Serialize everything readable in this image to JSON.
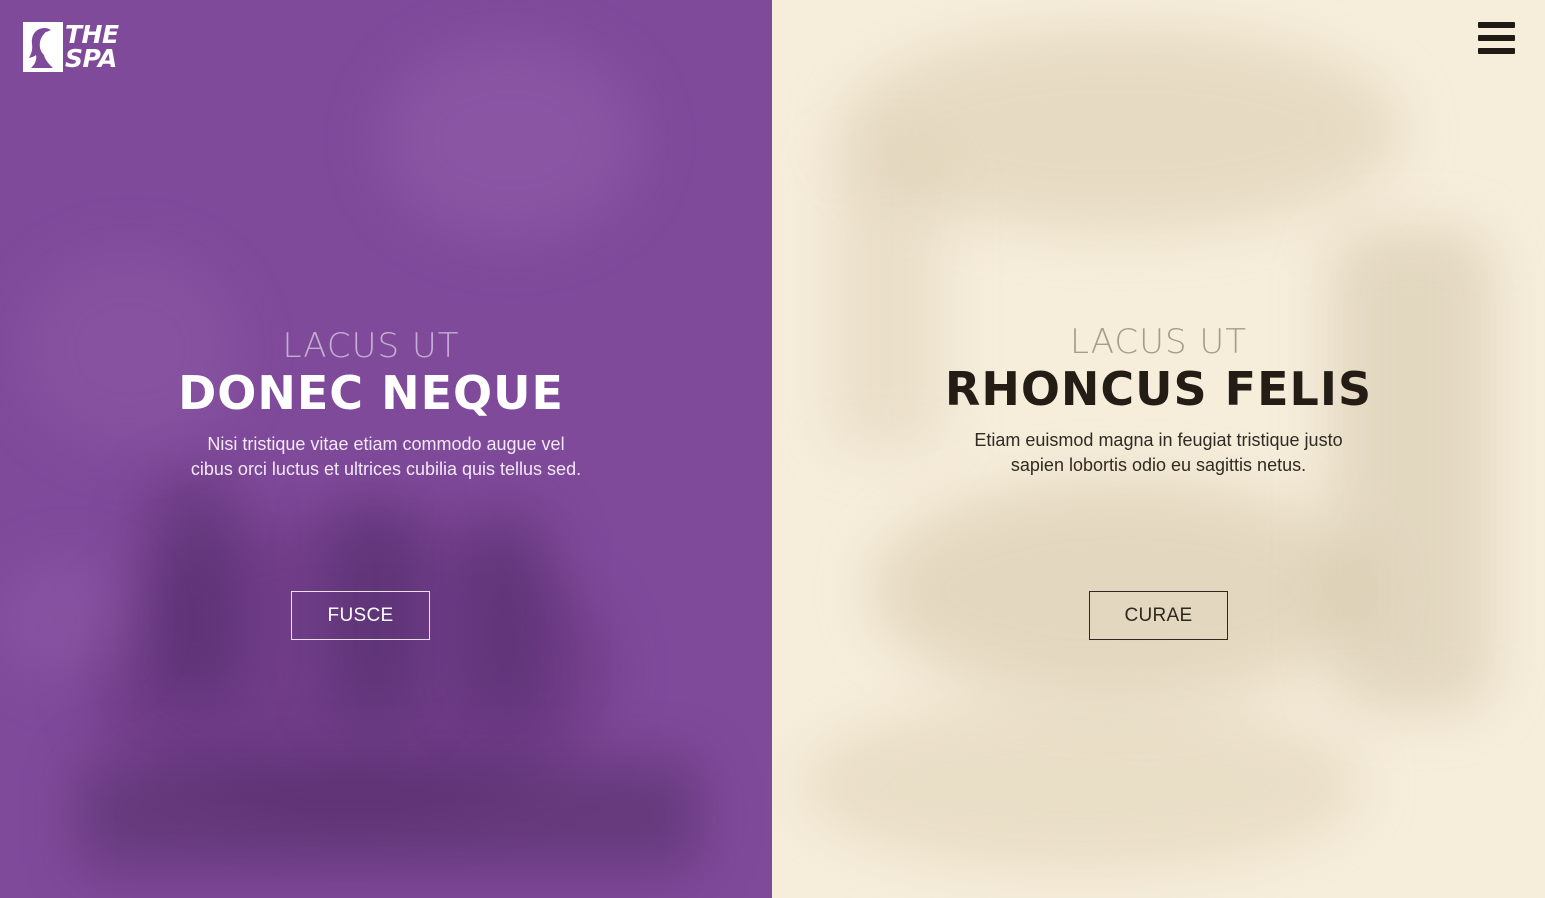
{
  "brand": {
    "logo_line1": "THE",
    "logo_line2": "SPA",
    "logo_icon": "woman-silhouette-icon"
  },
  "header": {
    "menu_icon": "hamburger-menu-icon"
  },
  "colors": {
    "left_panel": "#7f4a9a",
    "right_panel": "#f6eddb",
    "dark_text": "#231d15"
  },
  "panels": [
    {
      "kicker": "LACUS UT",
      "headline": "DONEC NEQUE",
      "description_line1": "Nisi tristique vitae etiam commodo augue vel",
      "description_line2": "cibus orci luctus et ultrices cubilia quis tellus sed.",
      "button_label": "FUSCE"
    },
    {
      "kicker": "LACUS UT",
      "headline": "RHONCUS FELIS",
      "description_line1": "Etiam euismod magna in feugiat tristique justo",
      "description_line2": "sapien lobortis odio eu sagittis netus.",
      "button_label": "CURAE"
    }
  ]
}
